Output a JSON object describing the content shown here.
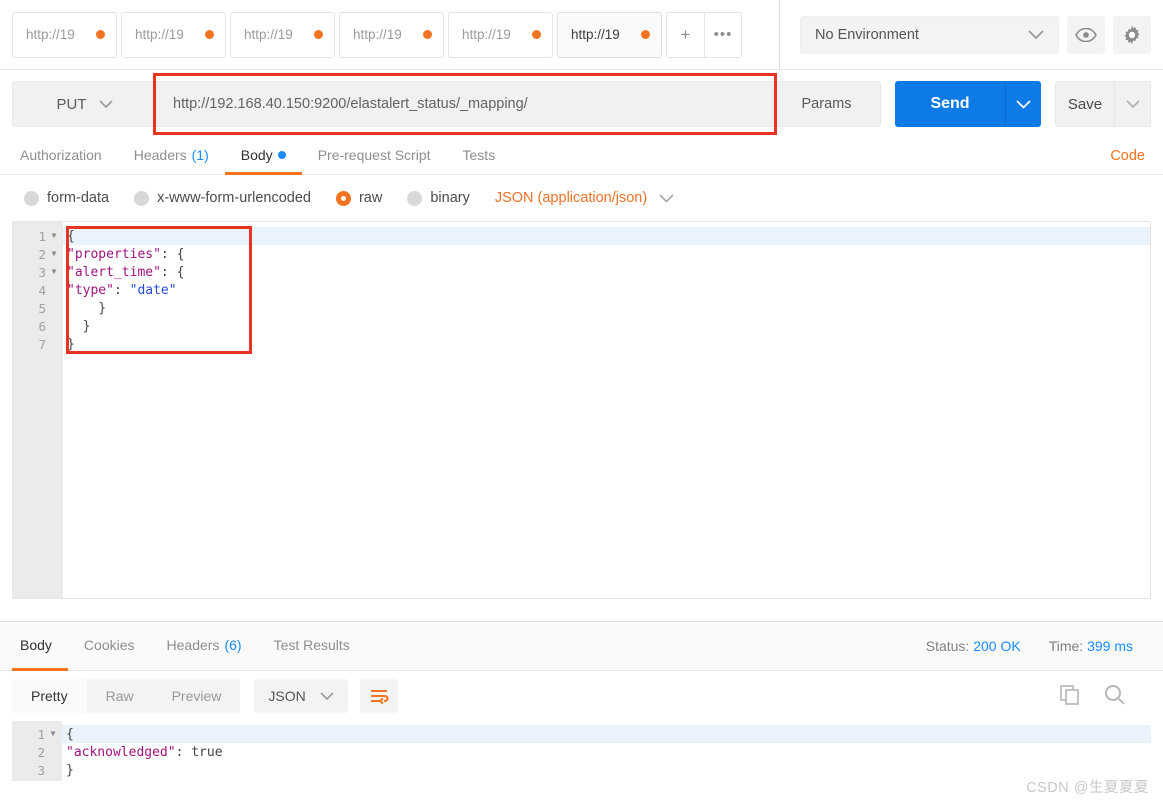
{
  "tabbar": {
    "tabs": [
      {
        "label": "http://19",
        "active": false
      },
      {
        "label": "http://19",
        "active": false
      },
      {
        "label": "http://19",
        "active": false
      },
      {
        "label": "http://19",
        "active": false
      },
      {
        "label": "http://19",
        "active": false
      },
      {
        "label": "http://19",
        "active": true
      }
    ],
    "new_tab_label": "+",
    "more_label": "•••",
    "environment": "No Environment",
    "eye_icon": "eye-icon",
    "gear_icon": "gear-icon"
  },
  "request": {
    "method": "PUT",
    "url": "http://192.168.40.150:9200/elastalert_status/_mapping/",
    "params_label": "Params",
    "send_label": "Send",
    "save_label": "Save"
  },
  "request_tabs": {
    "authorization": "Authorization",
    "headers": "Headers",
    "headers_count": "(1)",
    "body": "Body",
    "prerequest": "Pre-request Script",
    "tests": "Tests",
    "code": "Code"
  },
  "body_type": {
    "form_data": "form-data",
    "urlencoded": "x-www-form-urlencoded",
    "raw": "raw",
    "binary": "binary",
    "content_type": "JSON (application/json)"
  },
  "request_body": {
    "lines": [
      {
        "num": "1",
        "fold": true,
        "text": "{"
      },
      {
        "num": "2",
        "fold": true,
        "text": "  \"properties\": {"
      },
      {
        "num": "3",
        "fold": true,
        "text": "    \"alert_time\": {"
      },
      {
        "num": "4",
        "fold": false,
        "text": "      \"type\": \"date\""
      },
      {
        "num": "5",
        "fold": false,
        "text": "    }"
      },
      {
        "num": "6",
        "fold": false,
        "text": "  }"
      },
      {
        "num": "7",
        "fold": false,
        "text": "}"
      }
    ]
  },
  "response_tabs": {
    "body": "Body",
    "cookies": "Cookies",
    "headers": "Headers",
    "headers_count": "(6)",
    "test_results": "Test Results",
    "status_label": "Status:",
    "status_value": "200 OK",
    "time_label": "Time:",
    "time_value": "399 ms"
  },
  "response_format": {
    "pretty": "Pretty",
    "raw": "Raw",
    "preview": "Preview",
    "language": "JSON",
    "wrap_icon": "word-wrap-icon",
    "copy_icon": "copy-icon",
    "search_icon": "search-icon"
  },
  "response_body": {
    "lines": [
      {
        "num": "1",
        "fold": true,
        "text": "{"
      },
      {
        "num": "2",
        "fold": false,
        "text": "    \"acknowledged\": true"
      },
      {
        "num": "3",
        "fold": false,
        "text": "}"
      }
    ]
  },
  "watermark": "CSDN @生夏夏夏",
  "colors": {
    "accent_orange": "#f37321",
    "send_blue": "#0d7ae5",
    "link_blue": "#1a8cff",
    "highlight_red": "#e83323"
  }
}
